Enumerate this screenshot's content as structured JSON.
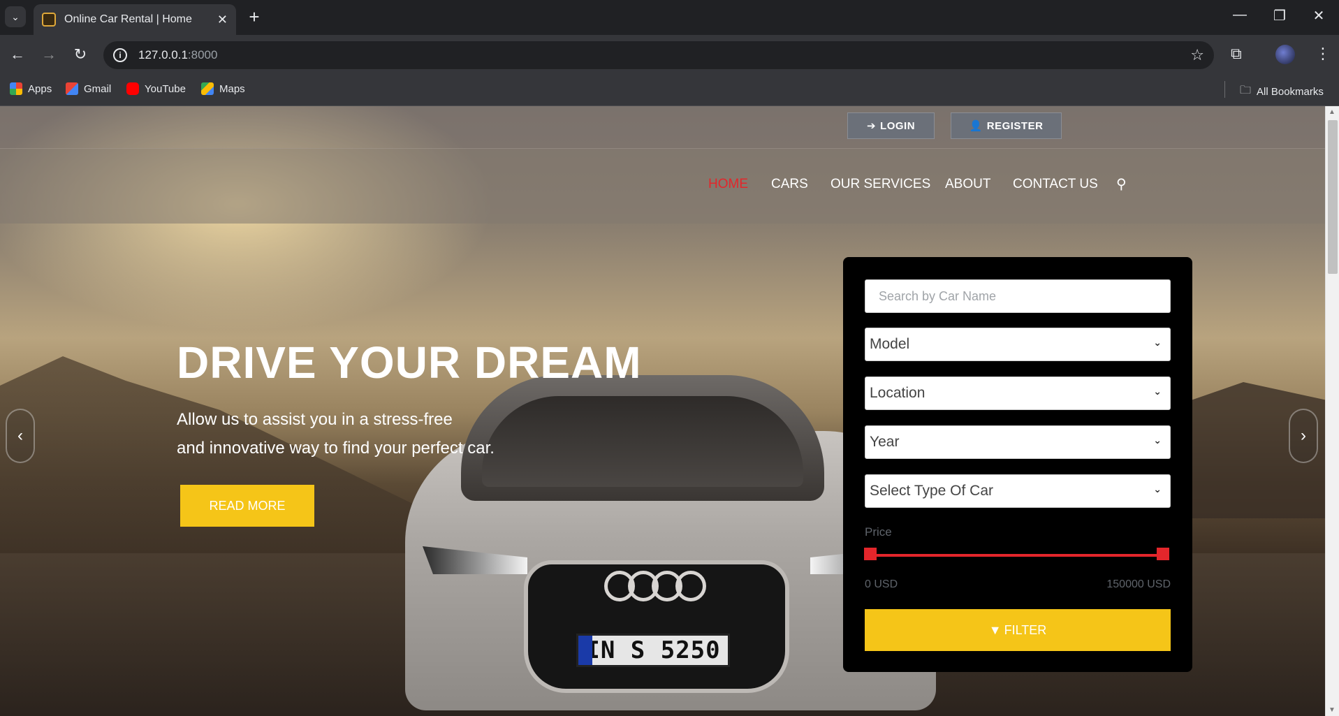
{
  "browser": {
    "tab_title": "Online Car Rental | Home",
    "url_host": "127.0.0.1",
    "url_port": ":8000",
    "bookmarks": [
      {
        "label": "Apps"
      },
      {
        "label": "Gmail"
      },
      {
        "label": "YouTube"
      },
      {
        "label": "Maps"
      }
    ],
    "all_bookmarks": "All Bookmarks"
  },
  "site": {
    "login": "LOGIN",
    "register": "REGISTER",
    "nav": [
      "HOME",
      "CARS",
      "OUR SERVICES",
      "ABOUT",
      "CONTACT US"
    ],
    "active_nav": "HOME"
  },
  "hero": {
    "title": "DRIVE YOUR DREAM",
    "subtitle_line1": "Allow us to assist you in a stress-free",
    "subtitle_line2": "and innovative way to find your perfect car.",
    "cta": "READ MORE",
    "plate": "IN S 5250"
  },
  "filter": {
    "search_placeholder": "Search by Car Name",
    "model": "Model",
    "location": "Location",
    "year": "Year",
    "type": "Select Type Of Car",
    "price_label": "Price",
    "price_min": "0 USD",
    "price_max": "150000 USD",
    "price_range": [
      0,
      150000
    ],
    "button": "FILTER"
  },
  "colors": {
    "accent": "#f5c518",
    "active": "#e3262b"
  }
}
